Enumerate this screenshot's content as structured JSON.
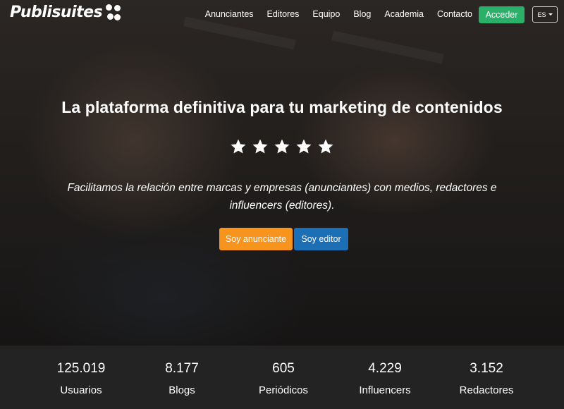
{
  "brand": {
    "name": "Publisuites"
  },
  "nav": {
    "links": [
      "Anunciantes",
      "Editores",
      "Equipo",
      "Blog",
      "Academia",
      "Contacto"
    ],
    "login_label": "Acceder",
    "language": "ES"
  },
  "hero": {
    "headline": "La plataforma definitiva para tu marketing de contenidos",
    "rating_stars": 5,
    "subtitle": "Facilitamos la relación entre marcas y empresas (anunciantes) con medios, redactores e influencers (editores).",
    "cta_advertiser": "Soy anunciante",
    "cta_editor": "Soy editor"
  },
  "stats": [
    {
      "value": "125.019",
      "label": "Usuarios"
    },
    {
      "value": "8.177",
      "label": "Blogs"
    },
    {
      "value": "605",
      "label": "Periódicos"
    },
    {
      "value": "4.229",
      "label": "Influencers"
    },
    {
      "value": "3.152",
      "label": "Redactores"
    }
  ],
  "colors": {
    "accent_green": "#2bb06a",
    "accent_orange": "#f7941d",
    "accent_blue": "#1d6fb5",
    "stats_bg": "#232323"
  },
  "icons": {
    "logo_mark": "publisuites-dots-icon",
    "star": "star-icon",
    "caret": "caret-down-icon"
  }
}
